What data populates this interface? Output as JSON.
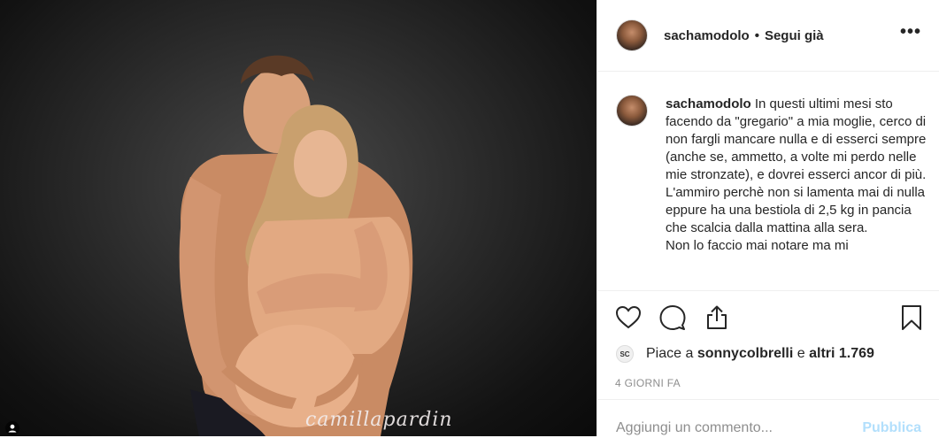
{
  "post": {
    "image": {
      "watermark": "camillapardin",
      "description_icon": "person-tag-icon"
    },
    "header": {
      "username": "sachamodolo",
      "separator": "•",
      "follow_status": "Segui già",
      "more_icon": "more-options-icon",
      "more_label": "•••"
    },
    "caption": {
      "username": "sachamodolo",
      "text_lines": [
        "In questi ultimi mesi sto facendo da \"gregario\" a mia moglie, cerco di non fargli mancare nulla e di esserci sempre (anche se, ammetto, a volte mi perdo nelle mie stronzate), e dovrei esserci ancor di più.",
        "L'ammiro perchè non si lamenta mai di nulla eppure ha una bestiola di 2,5 kg in pancia che scalcia dalla mattina alla sera.",
        "Non lo faccio mai notare ma mi"
      ]
    },
    "actions": {
      "like_icon": "heart-icon",
      "comment_icon": "comment-icon",
      "share_icon": "share-icon",
      "save_icon": "bookmark-icon"
    },
    "likes": {
      "prefix": "Piace a",
      "liker": "sonnycolbrelli",
      "conjunction": "e",
      "others": "altri 1.769",
      "liker_avatar_text": "SC"
    },
    "time_ago": "4 GIORNI FA",
    "comment": {
      "placeholder": "Aggiungi un commento...",
      "value": "",
      "submit_label": "Pubblica"
    }
  }
}
